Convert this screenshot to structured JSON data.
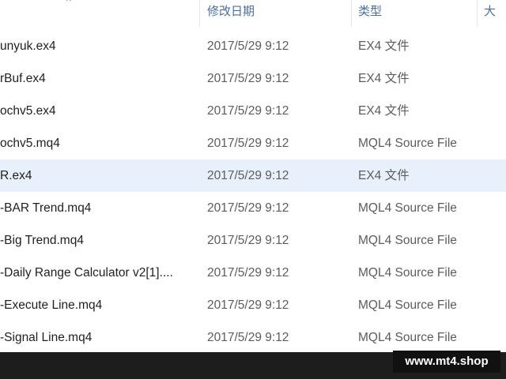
{
  "header": {
    "sort_indicator": "^",
    "columns": [
      {
        "label": "修改日期"
      },
      {
        "label": "类型"
      },
      {
        "label": "大小"
      }
    ]
  },
  "files": [
    {
      "name": "unyuk.ex4",
      "date": "2017/5/29 9:12",
      "type": "EX4 文件",
      "selected": false
    },
    {
      "name": "rBuf.ex4",
      "date": "2017/5/29 9:12",
      "type": "EX4 文件",
      "selected": false
    },
    {
      "name": "ochv5.ex4",
      "date": "2017/5/29 9:12",
      "type": "EX4 文件",
      "selected": false
    },
    {
      "name": "ochv5.mq4",
      "date": "2017/5/29 9:12",
      "type": "MQL4 Source File",
      "selected": false
    },
    {
      "name": "R.ex4",
      "date": "2017/5/29 9:12",
      "type": "EX4 文件",
      "selected": true
    },
    {
      "name": "-BAR Trend.mq4",
      "date": "2017/5/29 9:12",
      "type": "MQL4 Source File",
      "selected": false
    },
    {
      "name": "-Big Trend.mq4",
      "date": "2017/5/29 9:12",
      "type": "MQL4 Source File",
      "selected": false
    },
    {
      "name": "-Daily Range Calculator v2[1]....",
      "date": "2017/5/29 9:12",
      "type": "MQL4 Source File",
      "selected": false
    },
    {
      "name": "-Execute Line.mq4",
      "date": "2017/5/29 9:12",
      "type": "MQL4 Source File",
      "selected": false
    },
    {
      "name": "-Signal Line.mq4",
      "date": "2017/5/29 9:12",
      "type": "MQL4 Source File",
      "selected": false
    }
  ],
  "watermark": "www.mt4.shop",
  "colors": {
    "header_text": "#4a6f9a",
    "selected_row": "#e8f1fb",
    "taskbar": "#1d1d1d"
  }
}
